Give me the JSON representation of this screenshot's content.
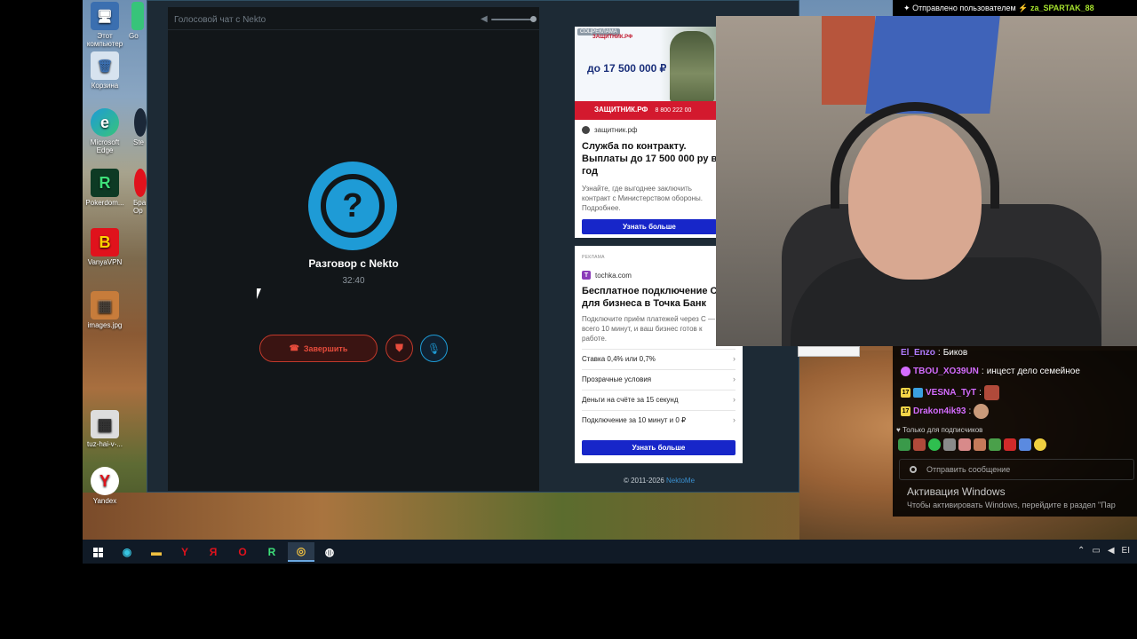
{
  "desktop": {
    "icons": [
      {
        "label": "Этот компьютер",
        "glyph": "🖥"
      },
      {
        "label": "Корзина",
        "glyph": "🗑"
      },
      {
        "label": "Microsoft Edge",
        "glyph": "e"
      },
      {
        "label": "Pokerdom...",
        "glyph": "R"
      },
      {
        "label": "VanyaVPN",
        "glyph": "B"
      },
      {
        "label": "images.jpg",
        "glyph": "▦"
      },
      {
        "label": "tuz-hai-v-...",
        "glyph": "▦"
      },
      {
        "label": "Yandex",
        "glyph": "Y"
      }
    ],
    "partial_icons": [
      "Go",
      "Ste",
      "Бра Op"
    ]
  },
  "chat_window": {
    "header": "Голосовой чат с Nekto",
    "title": "Разговор с Nekto",
    "timer": "32:40",
    "end_button": "Завершить",
    "avatar_glyph": "?",
    "copyright_text": "© 2011-2026",
    "copyright_link": "NektoMe"
  },
  "ad1": {
    "tag": "СОЦРЕКЛАМА",
    "logo": "ЗАЩИТНИК.РФ",
    "sum": "до 17 500 000 ₽",
    "strip": "ЗАЩИТНИК.РФ",
    "phone": "8 800 222 00",
    "domain": "защитник.рф",
    "headline": "Служба по контракту. Выплаты до 17 500 000 ру в год",
    "body": "Узнайте, где выгоднее заключить контракт с Министерством обороны. Подробнее.",
    "button": "Узнать больше"
  },
  "ad2": {
    "label": "РЕКЛАМА",
    "domain": "tochka.com",
    "logo": "T",
    "headline": "Бесплатное подключение С для бизнеса в Точка Банк",
    "body": "Подключите приём платежей через С — всего 10 минут, и ваш бизнес готов к работе.",
    "rows": [
      "Ставка 0,4% или 0,7%",
      "Прозрачные условия",
      "Деньги на счёте за 15 секунд",
      "Подключение за 10 минут и 0 ₽"
    ],
    "button": "Узнать больше"
  },
  "stream": {
    "sent_by_prefix": "Отправлено пользователем",
    "sent_by_user": "za_SPARTAK_88",
    "messages": [
      {
        "user": "El_Enzo",
        "color": "#b07cff",
        "text": "Биков"
      },
      {
        "user": "TBOU_XO39UN",
        "color": "#d46cff",
        "text": "инцест дело семейное"
      },
      {
        "user": "VESNA_TyT",
        "color": "#d46cff",
        "text": ""
      },
      {
        "user": "Drakon4ik93",
        "color": "#d46cff",
        "text": ""
      }
    ],
    "subs_only": "Только для подписчиков",
    "input_placeholder": "Отправить сообщение"
  },
  "windows_activation": {
    "title": "Активация Windows",
    "subtitle": "Чтобы активировать Windows, перейдите в раздел \"Пар"
  },
  "taskbar": {
    "items": [
      "start",
      "edge",
      "explorer",
      "yandex-browser",
      "yandex",
      "opera",
      "pokerdom",
      "chrome",
      "obs"
    ],
    "tray_lang": "EI"
  },
  "colors": {
    "accent": "#1e9bd6",
    "danger": "#e74c3c",
    "ad_button": "#1726c9"
  }
}
